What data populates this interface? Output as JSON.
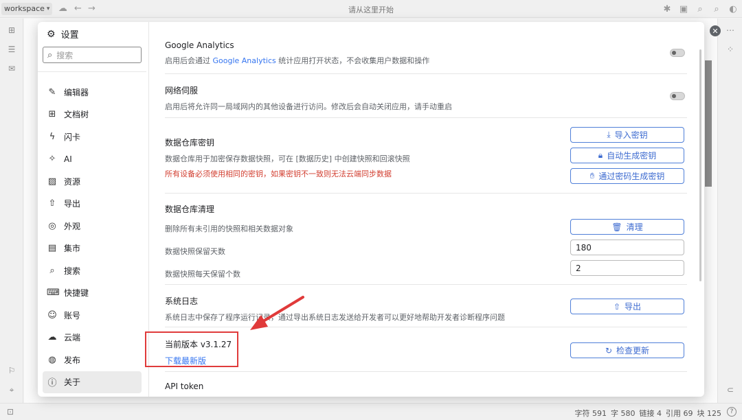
{
  "topbar": {
    "workspace": "workspace",
    "title": "请从这里开始"
  },
  "settings": {
    "title": "设置",
    "search_placeholder": "搜索",
    "nav": [
      {
        "label": "编辑器",
        "icon": "pencil-icon"
      },
      {
        "label": "文档树",
        "icon": "tree-icon"
      },
      {
        "label": "闪卡",
        "icon": "flash-icon"
      },
      {
        "label": "AI",
        "icon": "sparkle-icon"
      },
      {
        "label": "资源",
        "icon": "image-icon"
      },
      {
        "label": "导出",
        "icon": "upload-icon"
      },
      {
        "label": "外观",
        "icon": "palette-icon"
      },
      {
        "label": "集市",
        "icon": "store-icon"
      },
      {
        "label": "搜索",
        "icon": "search-icon"
      },
      {
        "label": "快捷键",
        "icon": "keyboard-icon"
      },
      {
        "label": "账号",
        "icon": "user-icon"
      },
      {
        "label": "云端",
        "icon": "cloud-icon"
      },
      {
        "label": "发布",
        "icon": "globe-icon"
      },
      {
        "label": "关于",
        "icon": "info-icon"
      }
    ],
    "active_nav": "关于"
  },
  "about": {
    "ga": {
      "title": "Google Analytics",
      "desc_pre": "启用后会通过 ",
      "desc_link": "Google Analytics",
      "desc_post": " 统计应用打开状态，不会收集用户数据和操作",
      "enabled": false
    },
    "network": {
      "title": "网络伺服",
      "desc": "启用后将允许同一局域网内的其他设备进行访问。修改后会自动关闭应用，请手动重启",
      "enabled": false
    },
    "repo_key": {
      "title": "数据仓库密钥",
      "desc": "数据仓库用于加密保存数据快照，可在 [数据历史] 中创建快照和回滚快照",
      "warn": "所有设备必须使用相同的密钥，如果密钥不一致则无法云端同步数据",
      "btn_import": "导入密钥",
      "btn_auto": "自动生成密钥",
      "btn_password": "通过密码生成密钥"
    },
    "repo_purge": {
      "title": "数据仓库清理",
      "desc": "删除所有未引用的快照和相关数据对象",
      "btn_purge": "清理",
      "retention_days_label": "数据快照保留天数",
      "retention_days_value": "180",
      "per_day_label": "数据快照每天保留个数",
      "per_day_value": "2"
    },
    "syslog": {
      "title": "系统日志",
      "desc": "系统日志中保存了程序运行记录，通过导出系统日志发送给开发者可以更好地帮助开发者诊断程序问题",
      "btn_export": "导出"
    },
    "version": {
      "label": "当前版本 v3.1.27",
      "download": "下载最新版",
      "btn_check": "检查更新"
    },
    "api_token": {
      "title": "API token"
    }
  },
  "statusbar": {
    "chars": "字符 591",
    "words": "字 580",
    "links": "链接 4",
    "refs": "引用 69",
    "blocks": "块 125",
    "help": "?"
  },
  "colors": {
    "accent": "#3d6bd0",
    "warning": "#d23f31",
    "annotation": "#e03a3a"
  }
}
